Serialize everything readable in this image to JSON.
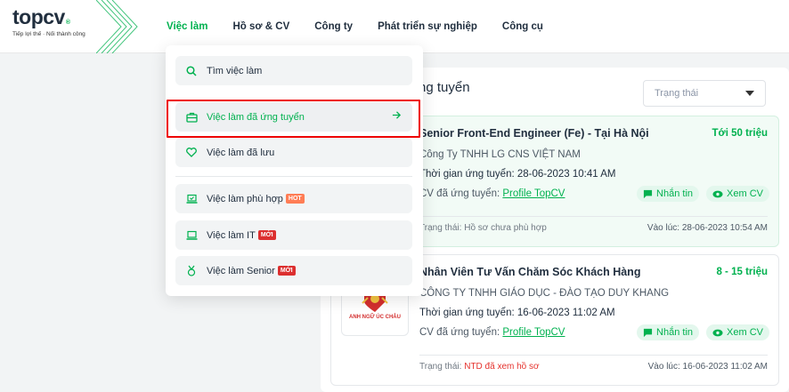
{
  "logo": {
    "brand_a": "top",
    "brand_b": "cv",
    "reg": "®",
    "tagline": "Tiếp lợi thế · Nối thành công"
  },
  "nav": [
    {
      "label": "Việc làm"
    },
    {
      "label": "Hồ sơ & CV"
    },
    {
      "label": "Công ty"
    },
    {
      "label": "Phát triển sự nghiệp"
    },
    {
      "label": "Công cụ"
    }
  ],
  "main": {
    "title_partial": "ng tuyển",
    "status_filter_placeholder": "Trạng thái"
  },
  "jobs": [
    {
      "title": "Senior Front-End Engineer (Fe) - Tại Hà Nội",
      "salary": "Tới 50 triệu",
      "company": "Công Ty TNHH LG CNS VIỆT NAM",
      "applied_time": "Thời gian ứng tuyển: 28-06-2023 10:41 AM",
      "cv_prefix": "CV đã ứng tuyển: ",
      "cv_link": "Profile TopCV",
      "message_label": "Nhắn tin",
      "view_cv_label": "Xem CV",
      "status_prefix": "Trạng thái: ",
      "status_value": "Hồ sơ chưa phù hợp",
      "updated_at": "Vào lúc: 28-06-2023 10:54 AM"
    },
    {
      "title": "Nhân Viên Tư Vấn Chăm Sóc Khách Hàng",
      "salary": "8 - 15 triệu",
      "company": "CÔNG TY TNHH GIÁO DỤC - ĐÀO TẠO DUY KHANG",
      "applied_time": "Thời gian ứng tuyển: 16-06-2023 11:02 AM",
      "cv_prefix": "CV đã ứng tuyển: ",
      "cv_link": "Profile TopCV",
      "message_label": "Nhắn tin",
      "view_cv_label": "Xem CV",
      "status_prefix": "Trạng thái: ",
      "status_value": "NTD đã xem hồ sơ",
      "updated_at": "Vào lúc: 16-06-2023 11:02 AM",
      "logo_text": "ANH NGỮ ÚC CHÂU"
    }
  ],
  "dropdown": {
    "items": [
      {
        "label": "Tìm việc làm",
        "icon": "search-icon"
      },
      {
        "label": "Việc làm đã ứng tuyển",
        "icon": "briefcase-icon"
      },
      {
        "label": "Việc làm đã lưu",
        "icon": "heart-icon"
      },
      {
        "label": "Việc làm phù hợp",
        "icon": "laptop-check-icon",
        "badge": "HOT"
      },
      {
        "label": "Việc làm IT",
        "icon": "laptop-icon",
        "badge": "MỚI"
      },
      {
        "label": "Việc làm Senior",
        "icon": "medal-icon",
        "badge": "MỚI"
      }
    ]
  },
  "colors": {
    "accent": "#00b14f",
    "highlight_border": "#e00000",
    "hot": "#ff7d55",
    "new": "#dc2f2f"
  }
}
